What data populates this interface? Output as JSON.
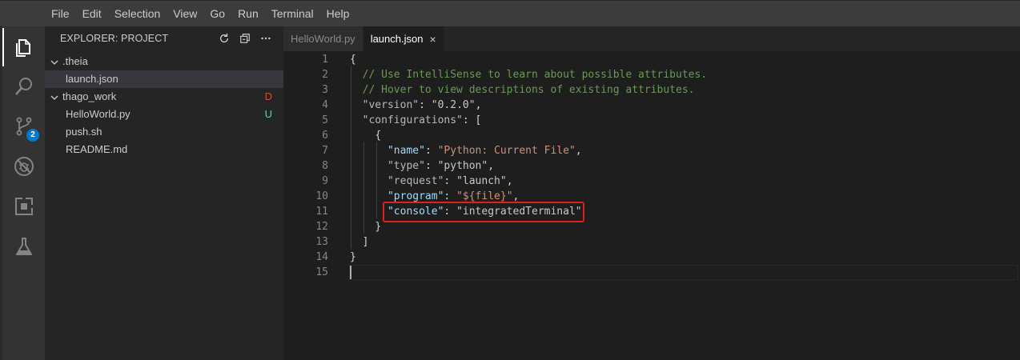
{
  "menu": [
    "File",
    "Edit",
    "Selection",
    "View",
    "Go",
    "Run",
    "Terminal",
    "Help"
  ],
  "activity": {
    "scm_badge": "2"
  },
  "explorer": {
    "title": "EXPLORER: PROJECT",
    "tree": [
      {
        "label": ".theia",
        "type": "folder",
        "status": ""
      },
      {
        "label": "launch.json",
        "type": "file",
        "status": ""
      },
      {
        "label": "thago_work",
        "type": "folder",
        "status": "D"
      },
      {
        "label": "HelloWorld.py",
        "type": "file",
        "status": "U"
      },
      {
        "label": "push.sh",
        "type": "file",
        "status": ""
      },
      {
        "label": "README.md",
        "type": "file",
        "status": ""
      }
    ]
  },
  "tabs": [
    {
      "label": "HelloWorld.py",
      "active": false
    },
    {
      "label": "launch.json",
      "active": true,
      "close": "×"
    }
  ],
  "editor": {
    "line_numbers": [
      "1",
      "2",
      "3",
      "4",
      "5",
      "6",
      "7",
      "8",
      "9",
      "10",
      "11",
      "12",
      "13",
      "14",
      "15"
    ],
    "lines": {
      "l1": "{",
      "l2": "// Use IntelliSense to learn about possible attributes.",
      "l3": "// Hover to view descriptions of existing attributes.",
      "l4_key": "\"version\"",
      "l4_val": "\"0.2.0\"",
      "l5_key": "\"configurations\"",
      "l5_rest": ": [",
      "l6": "{",
      "l7_key": "\"name\"",
      "l7_val": "\"Python: Current File\"",
      "l8_key": "\"type\"",
      "l8_val": "\"python\"",
      "l9_key": "\"request\"",
      "l9_val": "\"launch\"",
      "l10_key": "\"program\"",
      "l10_val": "\"${file}\"",
      "l11_key": "\"console\"",
      "l11_val": "\"integratedTerminal\"",
      "l12": "}",
      "l13": "]",
      "l14": "}",
      "l15": ""
    }
  },
  "colors": {
    "accent": "#007acc",
    "highlight_box": "#e0201a",
    "deleted": "#c74e39",
    "untracked": "#73c991"
  }
}
